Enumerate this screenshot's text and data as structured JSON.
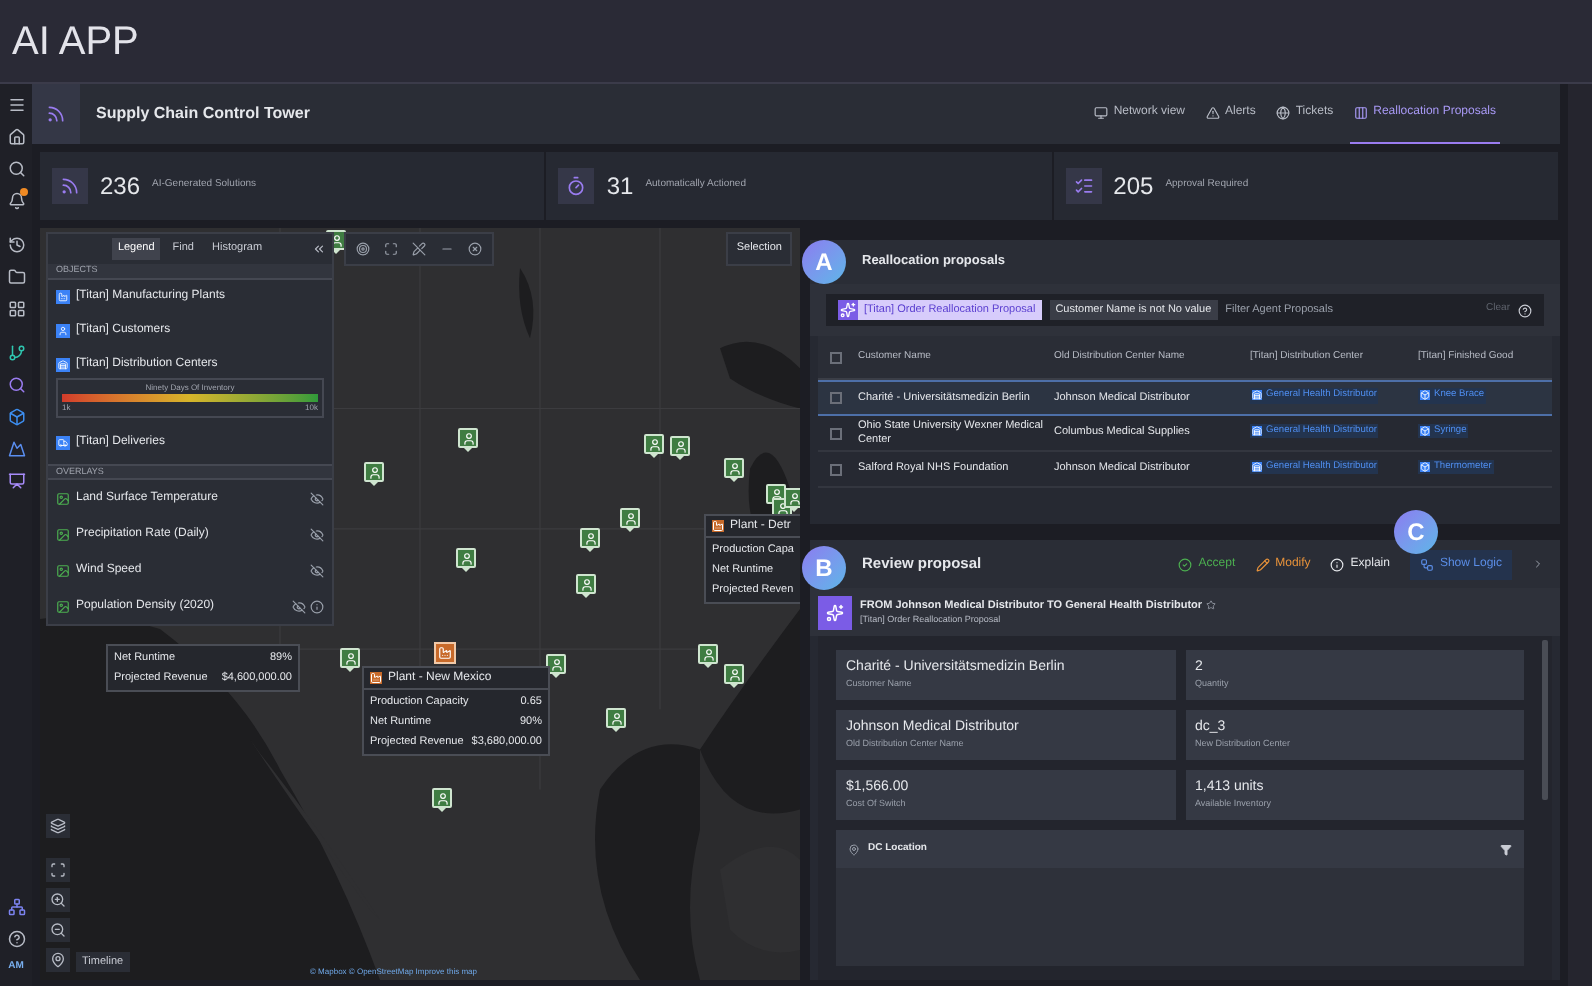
{
  "app_title": "AI APP",
  "user_initials": "AM",
  "header": {
    "title": "Supply Chain Control Tower",
    "tabs": [
      {
        "label": "Network view",
        "selected": false
      },
      {
        "label": "Alerts",
        "selected": false
      },
      {
        "label": "Tickets",
        "selected": false
      },
      {
        "label": "Reallocation Proposals",
        "selected": true
      }
    ]
  },
  "stats": [
    {
      "value": "236",
      "label": "AI-Generated Solutions"
    },
    {
      "value": "31",
      "label": "Automatically Actioned"
    },
    {
      "value": "205",
      "label": "Approval Required"
    }
  ],
  "map": {
    "panel_tabs": [
      {
        "label": "Legend",
        "selected": true
      },
      {
        "label": "Find",
        "selected": false
      },
      {
        "label": "Histogram",
        "selected": false
      }
    ],
    "objects_heading": "OBJECTS",
    "objects": [
      {
        "label": "[Titan] Manufacturing Plants"
      },
      {
        "label": "[Titan] Customers"
      },
      {
        "label": "[Titan] Distribution Centers",
        "gradient": {
          "title": "Ninety Days Of Inventory",
          "min": "1k",
          "max": "10k"
        }
      },
      {
        "label": "[Titan] Deliveries"
      }
    ],
    "overlays_heading": "OVERLAYS",
    "overlays": [
      {
        "label": "Land Surface Temperature",
        "info": false
      },
      {
        "label": "Precipitation Rate (Daily)",
        "info": false
      },
      {
        "label": "Wind Speed",
        "info": false
      },
      {
        "label": "Population Density (2020)",
        "info": true
      }
    ],
    "selection_button": "Selection",
    "popups": [
      {
        "title": "Plant - Detr",
        "rows": [
          {
            "label": "Production Capa",
            "value": ""
          },
          {
            "label": "Net Runtime",
            "value": ""
          },
          {
            "label": "Projected Reven",
            "value": ""
          }
        ]
      },
      {
        "title": "Plant - New Mexico",
        "rows": [
          {
            "label": "Production Capacity",
            "value": "0.65"
          },
          {
            "label": "Net Runtime",
            "value": "90%"
          },
          {
            "label": "Projected Revenue",
            "value": "$3,680,000.00"
          }
        ]
      },
      {
        "rows": [
          {
            "label": "Net Runtime",
            "value": "89%"
          },
          {
            "label": "Projected Revenue",
            "value": "$4,600,000.00"
          }
        ]
      }
    ],
    "timeline_button": "Timeline",
    "attribution": "© Mapbox © OpenStreetMap Improve this map"
  },
  "proposals": {
    "badge": "A",
    "title": "Reallocation proposals",
    "filter_chip": "[Titan] Order Reallocation Proposal",
    "filter_condition": "Customer Name is not No value",
    "search_placeholder": "Filter Agent Proposals",
    "clear": "Clear",
    "all_checked": false,
    "columns": [
      "Customer Name",
      "Old Distribution Center Name",
      "[Titan] Distribution Center",
      "[Titan] Finished Good"
    ],
    "rows": [
      {
        "selected": true,
        "checked": false,
        "cells": [
          "Charité - Universitätsmedizin Berlin",
          "Johnson Medical Distributor",
          "General Health Distributor",
          "Knee Brace"
        ]
      },
      {
        "selected": false,
        "checked": false,
        "cells": [
          "Ohio State University Wexner Medical Center",
          "Columbus Medical Supplies",
          "General Health Distributor",
          "Syringe"
        ]
      },
      {
        "selected": false,
        "checked": false,
        "cells": [
          "Salford Royal NHS Foundation",
          "Johnson Medical Distributor",
          "General Health Distributor",
          "Thermometer"
        ]
      }
    ]
  },
  "review": {
    "badge": "B",
    "title": "Review proposal",
    "logic_badge": "C",
    "actions": [
      {
        "kind": "accept",
        "label": "Accept"
      },
      {
        "kind": "modify",
        "label": "Modify"
      },
      {
        "kind": "explain",
        "label": "Explain"
      },
      {
        "kind": "logic",
        "label": "Show Logic"
      }
    ],
    "proposal_title": "FROM Johnson Medical Distributor TO General Health Distributor",
    "proposal_subtitle": "[Titan] Order Reallocation Proposal",
    "fields": [
      {
        "value": "Charité - Universitätsmedizin Berlin",
        "label": "Customer Name"
      },
      {
        "value": "2",
        "label": "Quantity"
      },
      {
        "value": "Johnson Medical Distributor",
        "label": "Old Distribution Center Name"
      },
      {
        "value": "dc_3",
        "label": "New Distribution Center"
      },
      {
        "value": "$1,566.00",
        "label": "Cost Of Switch"
      },
      {
        "value": "1,413 units",
        "label": "Available Inventory"
      }
    ],
    "location_title": "DC Location"
  }
}
